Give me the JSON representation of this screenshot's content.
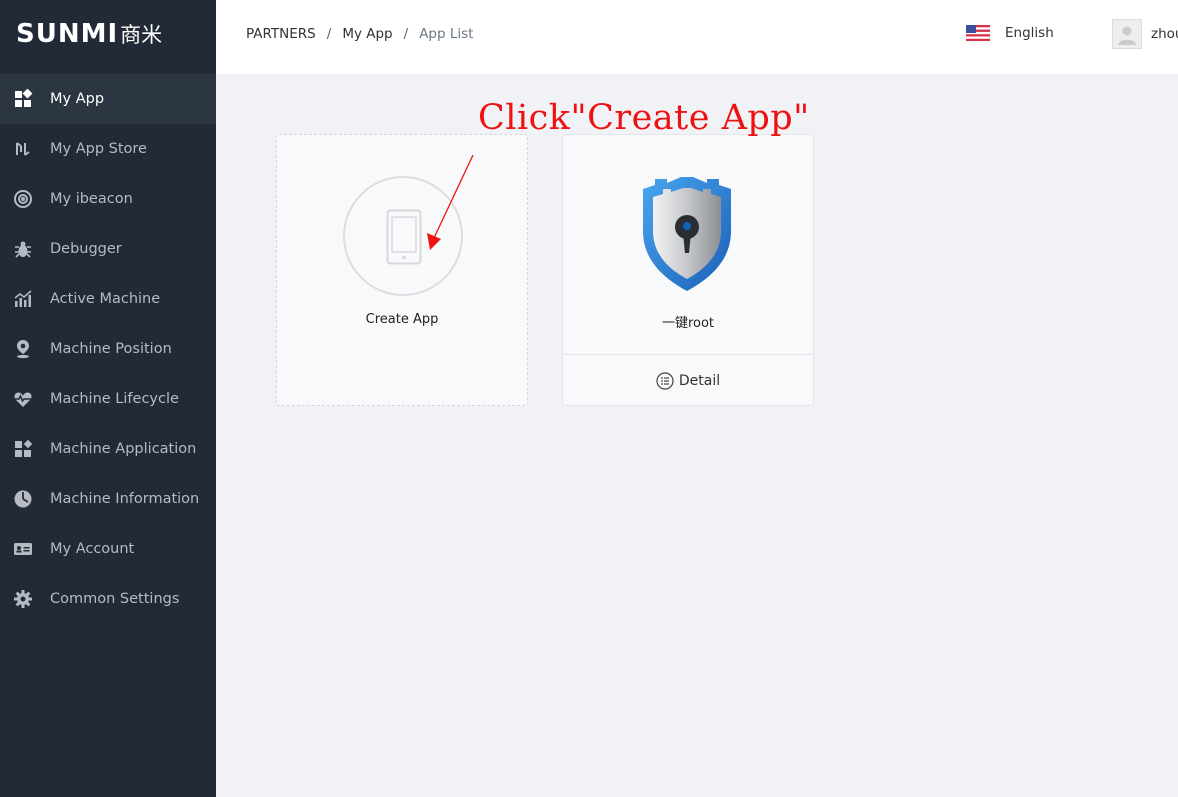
{
  "brand": {
    "logo_text": "SUNMI",
    "logo_cn": "商米"
  },
  "sidebar": {
    "items": [
      {
        "label": "My App",
        "icon": "grid-icon",
        "active": true
      },
      {
        "label": "My App Store",
        "icon": "store-icon",
        "active": false
      },
      {
        "label": "My ibeacon",
        "icon": "beacon-icon",
        "active": false
      },
      {
        "label": "Debugger",
        "icon": "bug-icon",
        "active": false
      },
      {
        "label": "Active Machine",
        "icon": "chart-icon",
        "active": false
      },
      {
        "label": "Machine Position",
        "icon": "location-pin-icon",
        "active": false
      },
      {
        "label": "Machine Lifecycle",
        "icon": "heartbeat-icon",
        "active": false
      },
      {
        "label": "Machine Application",
        "icon": "apps-icon",
        "active": false
      },
      {
        "label": "Machine Information",
        "icon": "pie-icon",
        "active": false
      },
      {
        "label": "My Account",
        "icon": "id-card-icon",
        "active": false
      },
      {
        "label": "Common Settings",
        "icon": "gear-icon",
        "active": false
      }
    ]
  },
  "header": {
    "breadcrumb": [
      "PARTNERS",
      "My App",
      "App List"
    ],
    "breadcrumb_sep": "/",
    "language": "English",
    "user": "zhou"
  },
  "cards": {
    "create": {
      "label": "Create App"
    },
    "app": {
      "name": "一键root",
      "detail_label": "Detail"
    }
  },
  "annotation": {
    "text": "Click\"Create App\"",
    "color": "#ee1111"
  },
  "colors": {
    "sidebar_bg": "#232a37",
    "sidebar_active": "#2c3542",
    "content_bg": "#f0f2f5"
  }
}
